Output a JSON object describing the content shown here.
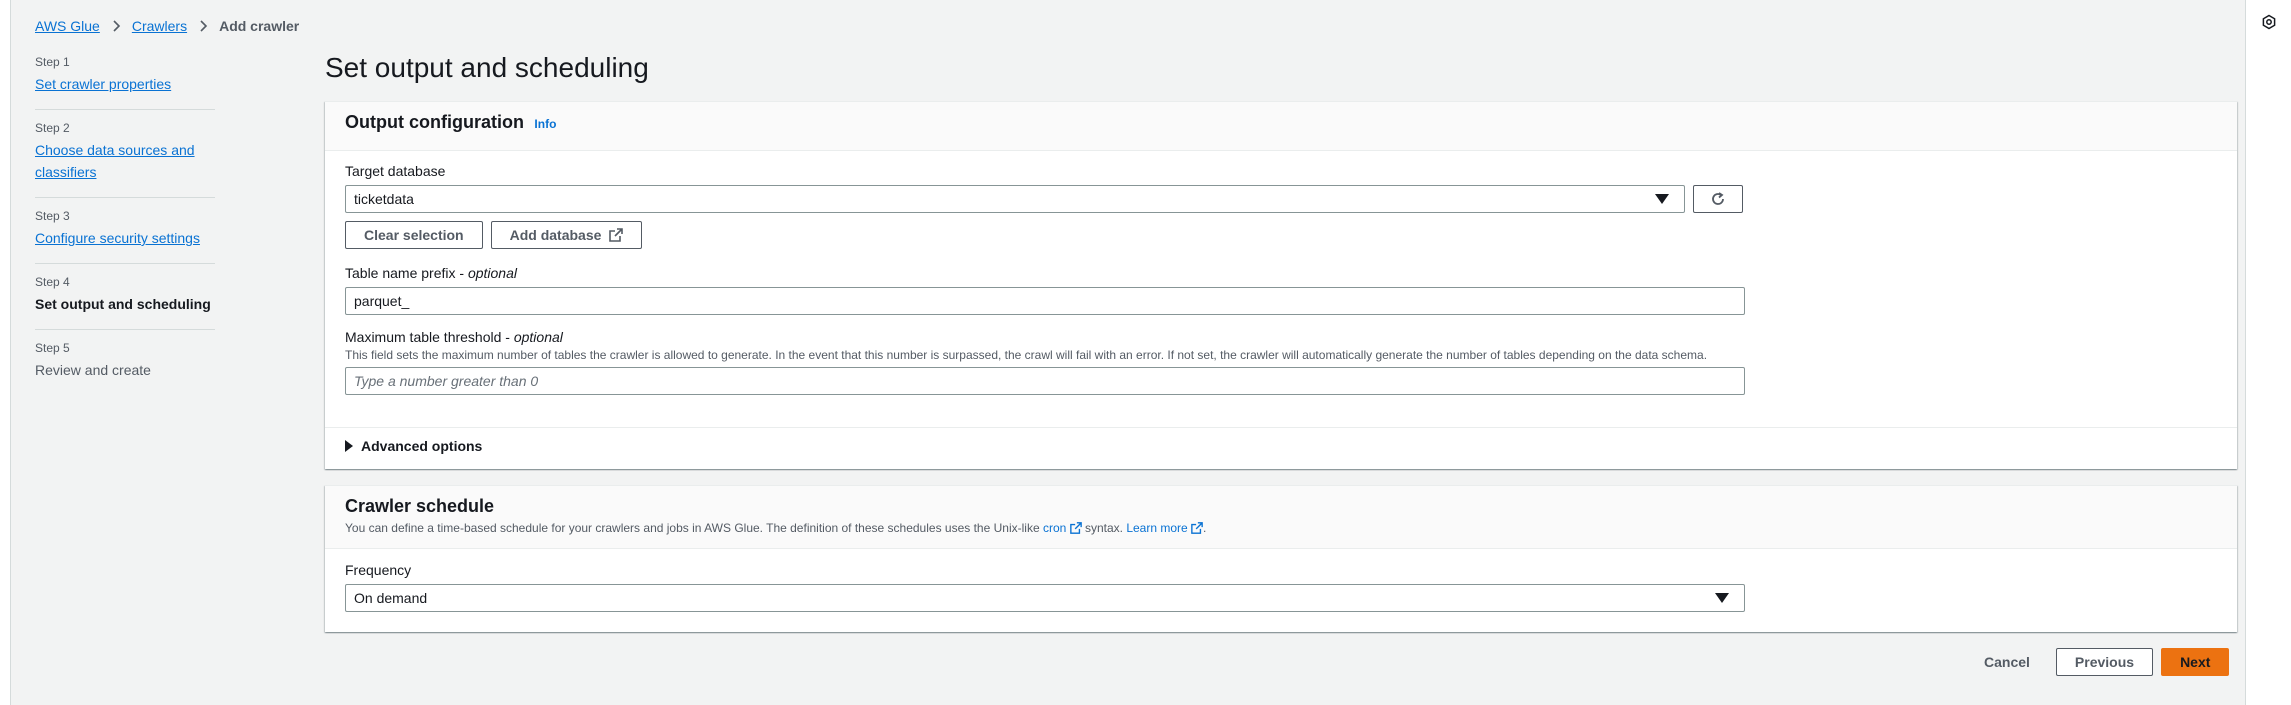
{
  "breadcrumb": {
    "items": [
      "AWS Glue",
      "Crawlers"
    ],
    "current": "Add crawler"
  },
  "steps": [
    {
      "num": "Step 1",
      "label": "Set crawler properties",
      "state": "link"
    },
    {
      "num": "Step 2",
      "label": "Choose data sources and classifiers",
      "state": "link"
    },
    {
      "num": "Step 3",
      "label": "Configure security settings",
      "state": "link"
    },
    {
      "num": "Step 4",
      "label": "Set output and scheduling",
      "state": "active"
    },
    {
      "num": "Step 5",
      "label": "Review and create",
      "state": "disabled"
    }
  ],
  "page_title": "Set output and scheduling",
  "output": {
    "title": "Output configuration",
    "info": "Info",
    "target_db_label": "Target database",
    "target_db_value": "ticketdata",
    "clear_selection": "Clear selection",
    "add_database": "Add database",
    "prefix_label": "Table name prefix - ",
    "prefix_optional": "optional",
    "prefix_value": "parquet_",
    "threshold_label": "Maximum table threshold - ",
    "threshold_optional": "optional",
    "threshold_desc": "This field sets the maximum number of tables the crawler is allowed to generate. In the event that this number is surpassed, the crawl will fail with an error. If not set, the crawler will automatically generate the number of tables depending on the data schema.",
    "threshold_placeholder": "Type a number greater than 0",
    "advanced_options": "Advanced options"
  },
  "schedule": {
    "title": "Crawler schedule",
    "desc_prefix": "You can define a time-based schedule for your crawlers and jobs in AWS Glue. The definition of these schedules uses the Unix-like ",
    "cron": "cron",
    "desc_mid": " syntax. ",
    "learn_more": "Learn more",
    "desc_end": ".",
    "frequency_label": "Frequency",
    "frequency_value": "On demand"
  },
  "footer": {
    "cancel": "Cancel",
    "previous": "Previous",
    "next": "Next"
  },
  "colors": {
    "link": "#0972d3",
    "primary": "#ec7211",
    "background": "#f2f3f3"
  },
  "icons": [
    "chevron-right-icon",
    "refresh-icon",
    "external-link-icon",
    "caret-down-icon",
    "caret-right-icon",
    "settings-icon"
  ]
}
